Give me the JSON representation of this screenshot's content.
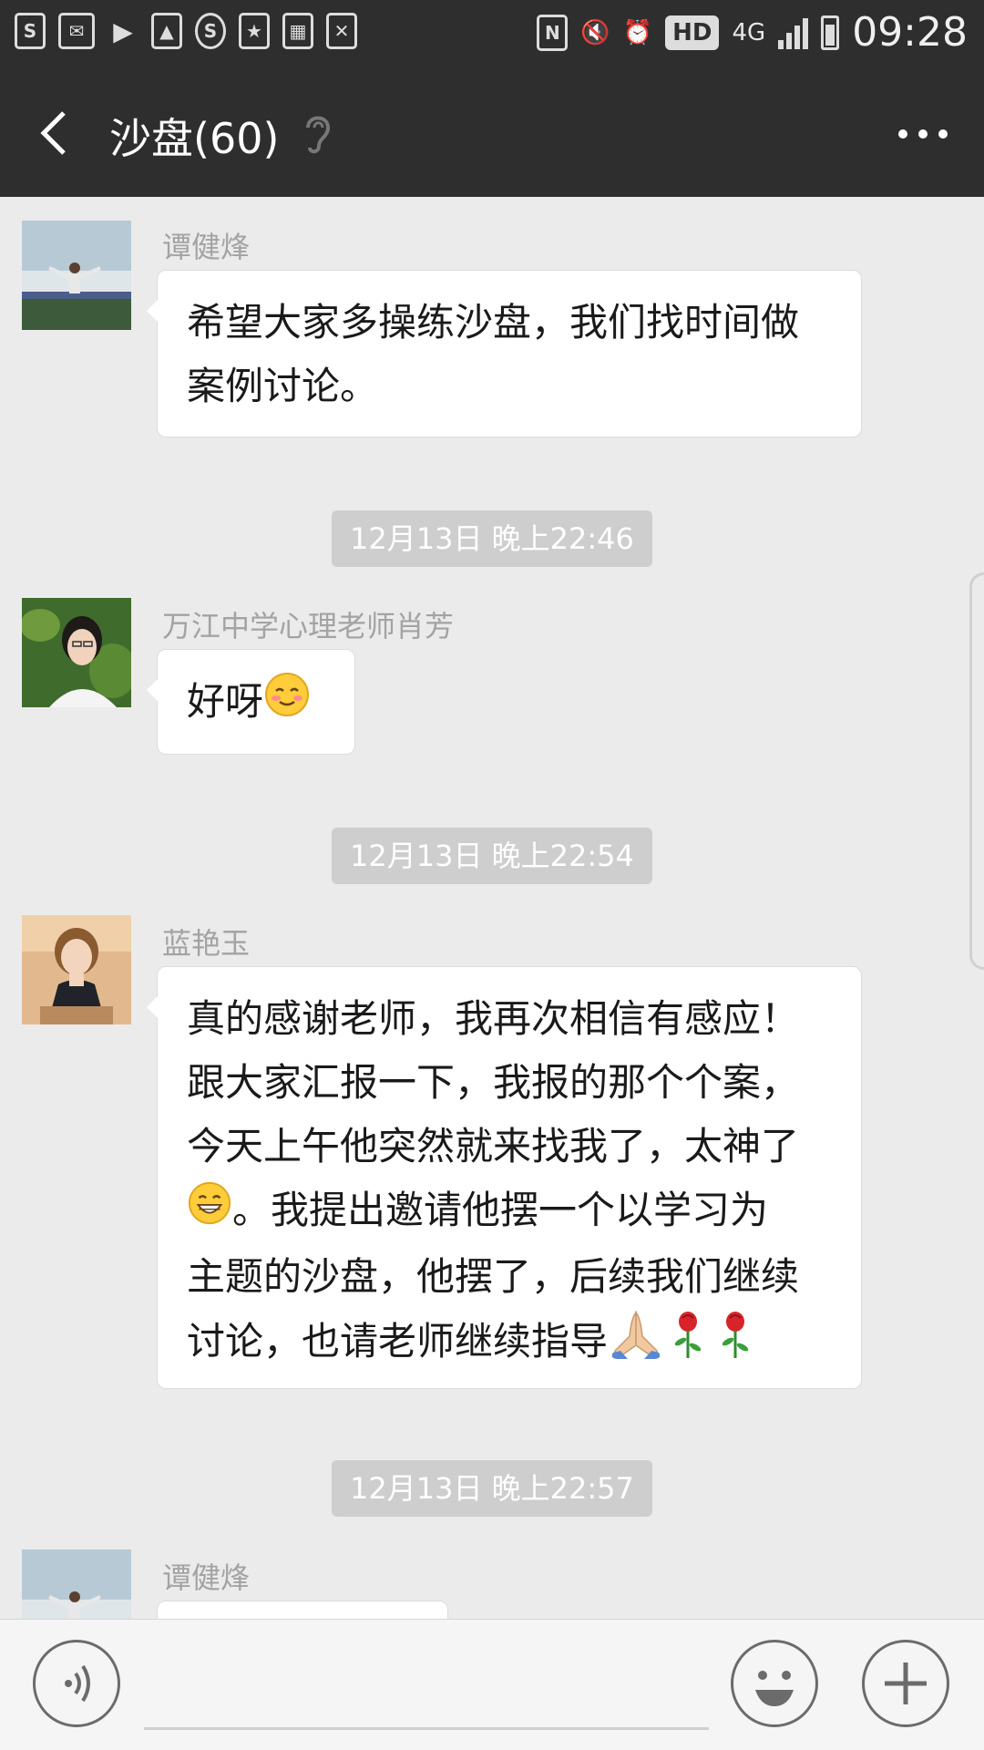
{
  "status_bar": {
    "time": "09:28",
    "network": "4G",
    "hd_badge": "HD",
    "left_icons": [
      "s-icon",
      "mail-s-icon",
      "play-icon",
      "image-icon",
      "s-circle-icon",
      "calendar-icon",
      "grid-icon",
      "email-icon"
    ],
    "right_icons": [
      "nfc-icon",
      "mute-icon",
      "alarm-icon",
      "signal-icon",
      "battery-icon"
    ]
  },
  "header": {
    "title": "沙盘(60)",
    "back_icon": "chevron-left-icon",
    "ear_icon": "ear-icon",
    "more_icon": "more-icon"
  },
  "messages": [
    {
      "type": "message",
      "sender": "谭健烽",
      "lines": [
        "希望大家多操练沙盘，我们找时间做",
        "案例讨论。"
      ],
      "avatar": "avatar-landscape"
    },
    {
      "type": "timestamp",
      "text": "12月13日 晚上22:46"
    },
    {
      "type": "message",
      "sender": "万江中学心理老师肖芳",
      "text": "好呀",
      "emoji": "blush-emoji",
      "avatar": "avatar-woman-glasses"
    },
    {
      "type": "timestamp",
      "text": "12月13日 晚上22:54"
    },
    {
      "type": "message",
      "sender": "蓝艳玉",
      "lines": [
        "真的感谢老师，我再次相信有感应！",
        "跟大家汇报一下，我报的那个个案，",
        "今天上午他突然就来找我了，太神了",
        "。我提出邀请他摆一个以学习为",
        "主题的沙盘，他摆了，后续我们继续",
        "讨论，也请老师继续指导"
      ],
      "emojis": [
        "grin-emoji",
        "pray-emoji",
        "rose-emoji",
        "rose-emoji"
      ],
      "avatar": "avatar-woman-portrait"
    },
    {
      "type": "timestamp",
      "text": "12月13日 晚上22:57"
    },
    {
      "type": "message",
      "sender": "谭健烽",
      "text": "",
      "avatar": "avatar-landscape"
    }
  ],
  "input_bar": {
    "voice_icon": "voice-icon",
    "emoji_icon": "smiley-icon",
    "plus_icon": "plus-icon"
  },
  "colors": {
    "header_bg": "#2e2e2e",
    "chat_bg": "#ebebeb",
    "bubble_bg": "#ffffff",
    "timestamp_bg": "#cecece",
    "sender_text": "#a3a3a3"
  }
}
